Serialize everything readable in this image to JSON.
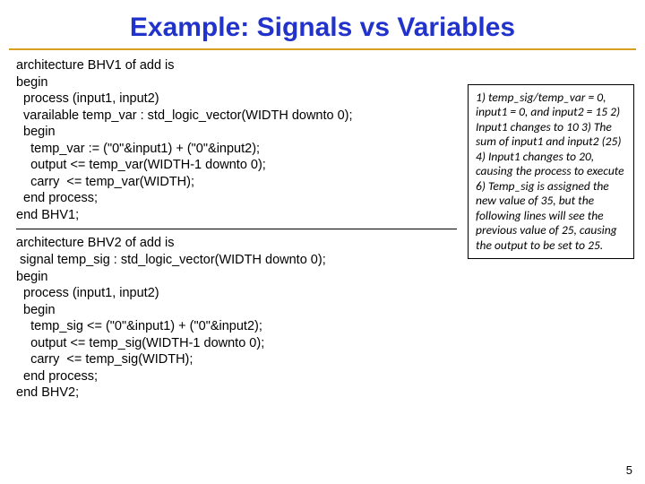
{
  "title": "Example: Signals vs Variables",
  "code1": "architecture BHV1 of add is\nbegin\n  process (input1, input2)\n  varailable temp_var : std_logic_vector(WIDTH downto 0);\n  begin\n    temp_var := (\"0\"&input1) + (\"0\"&input2);\n    output <= temp_var(WIDTH-1 downto 0);\n    carry  <= temp_var(WIDTH);\n  end process;\nend BHV1;",
  "code2": "architecture BHV2 of add is\n signal temp_sig : std_logic_vector(WIDTH downto 0);\nbegin\n  process (input1, input2)\n  begin\n    temp_sig <= (\"0\"&input1) + (\"0\"&input2);\n    output <= temp_sig(WIDTH-1 downto 0);\n    carry  <= temp_sig(WIDTH);\n  end process;\nend BHV2;",
  "notes": "1) temp_sig/temp_var = 0, input1 = 0, and input2 = 15\n2) Input1 changes to 10\n3) The sum of input1 and input2 (25)\n4) Input1 changes to 20, causing the process to execute\n6) Temp_sig is assigned the new value of 35, but the following lines will see the previous value of 25, causing the output to be set to 25.",
  "page_number": "5"
}
